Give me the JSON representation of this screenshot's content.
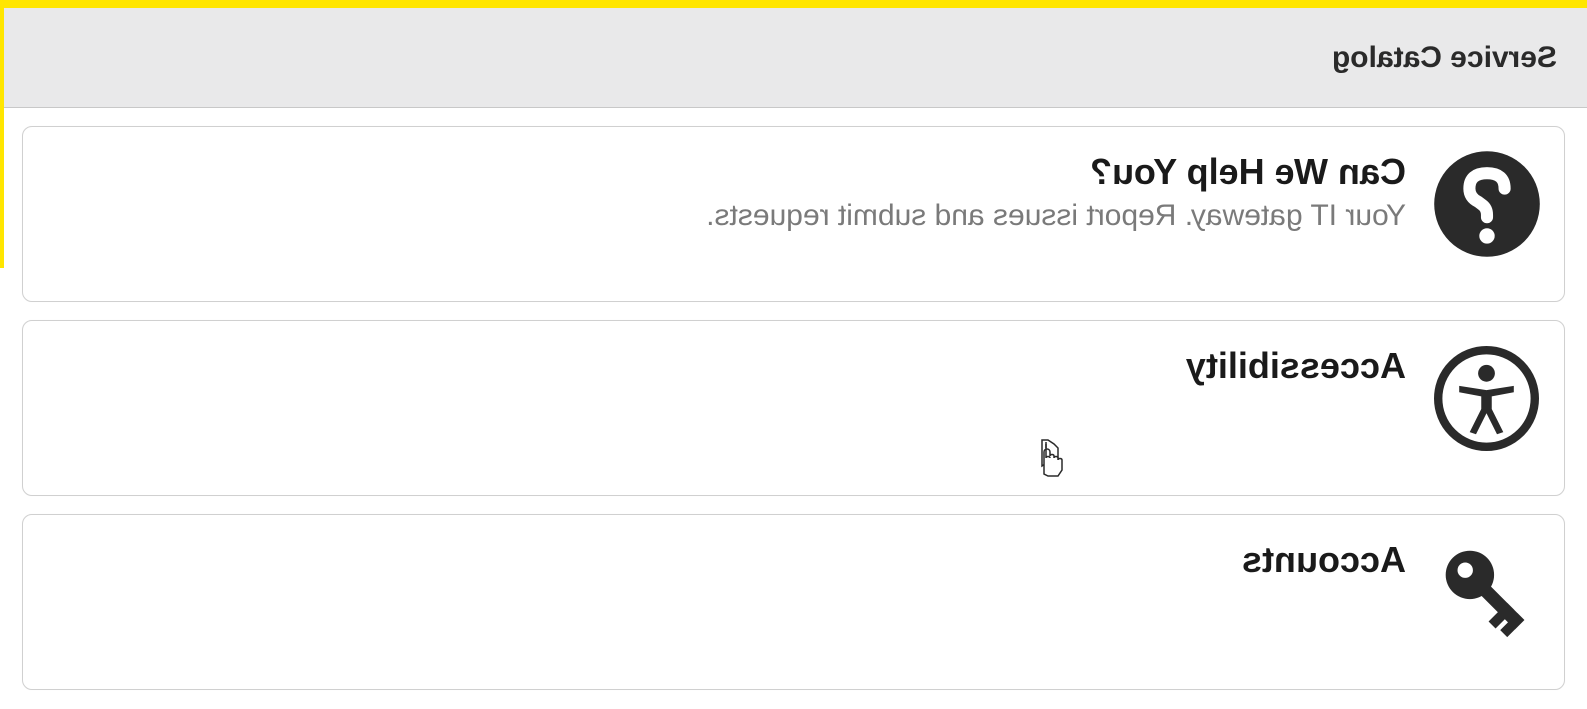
{
  "header": {
    "title": "Service Catalog"
  },
  "cards": [
    {
      "icon": "question-icon",
      "title": "Can We Help You?",
      "description": "Your IT gateway. Report issues and submit requests."
    },
    {
      "icon": "accessibility-icon",
      "title": "Accessibility",
      "description": ""
    },
    {
      "icon": "key-icon",
      "title": "Accounts",
      "description": ""
    }
  ]
}
